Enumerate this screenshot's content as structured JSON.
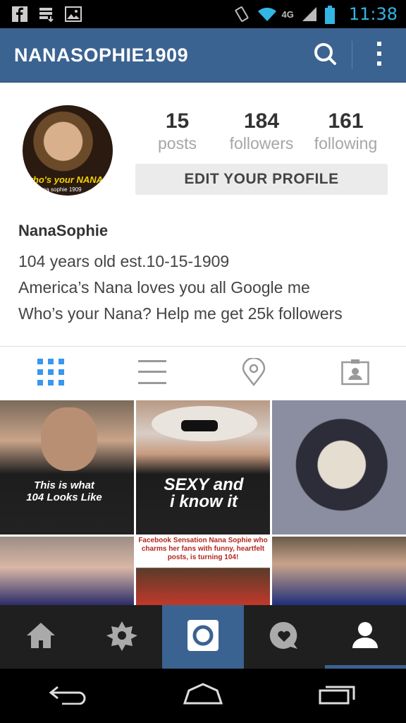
{
  "status_bar": {
    "time": "11:38",
    "network": "4G",
    "icons": [
      "facebook-icon",
      "download-icon",
      "image-icon",
      "vibrate-icon",
      "wifi-icon",
      "signal-icon",
      "battery-icon"
    ]
  },
  "app_bar": {
    "title": "NANASOPHIE1909",
    "icons": [
      "search-icon",
      "overflow-menu-icon"
    ]
  },
  "profile": {
    "avatar_text": "who's your NANA?",
    "avatar_caption": "nana sophie 1909",
    "stats": [
      {
        "value": "15",
        "label": "posts"
      },
      {
        "value": "184",
        "label": "followers"
      },
      {
        "value": "161",
        "label": "following"
      }
    ],
    "edit_button": "EDIT YOUR PROFILE",
    "display_name": "NanaSophie",
    "bio_lines": [
      "104 years old est.10-15-1909",
      "America’s Nana loves you all Google me",
      "Who’s your Nana? Help me get 25k followers"
    ]
  },
  "view_tabs": [
    {
      "icon": "grid-icon",
      "active": true
    },
    {
      "icon": "list-icon",
      "active": false
    },
    {
      "icon": "location-pin-icon",
      "active": false
    },
    {
      "icon": "tagged-photos-icon",
      "active": false
    }
  ],
  "posts": [
    {
      "caption": "This is what 104 Looks Like"
    },
    {
      "caption": "SEXY and i know it"
    },
    {
      "caption": ""
    },
    {
      "caption": ""
    },
    {
      "caption": "Facebook Sensation Nana Sophie who charms her fans with funny, heartfelt posts, is turning 104!"
    },
    {
      "caption": ""
    }
  ],
  "bottom_nav": [
    "home-icon",
    "explore-icon",
    "camera-icon",
    "activity-icon",
    "profile-icon"
  ],
  "colors": {
    "brand": "#3b6391",
    "accent": "#3897f0",
    "status_time": "#33b5e5"
  }
}
